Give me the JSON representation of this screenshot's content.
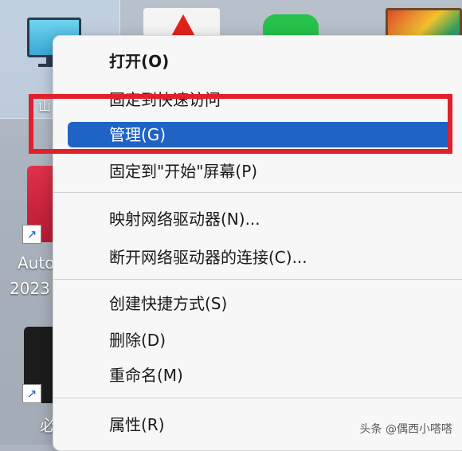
{
  "desktop": {
    "labels": {
      "autocad_name": "Auto",
      "autocad_year": "2023",
      "label_top": "山",
      "label_bottom": "必"
    },
    "badge_glyph": "↗"
  },
  "context_menu": {
    "items": [
      {
        "label": "打开(O)"
      },
      {
        "label": "固定到快速访问"
      },
      {
        "label": "管理(G)"
      },
      {
        "label": "固定到\"开始\"屏幕(P)"
      },
      {
        "label": "映射网络驱动器(N)..."
      },
      {
        "label": "断开网络驱动器的连接(C)..."
      },
      {
        "label": "创建快捷方式(S)"
      },
      {
        "label": "删除(D)"
      },
      {
        "label": "重命名(M)"
      },
      {
        "label": "属性(R)"
      }
    ],
    "selected_index": 2
  },
  "watermark": "头条 @偶西小嗒嗒",
  "colors": {
    "highlight": "#1f63c4",
    "annotation_red": "#e0202a"
  }
}
